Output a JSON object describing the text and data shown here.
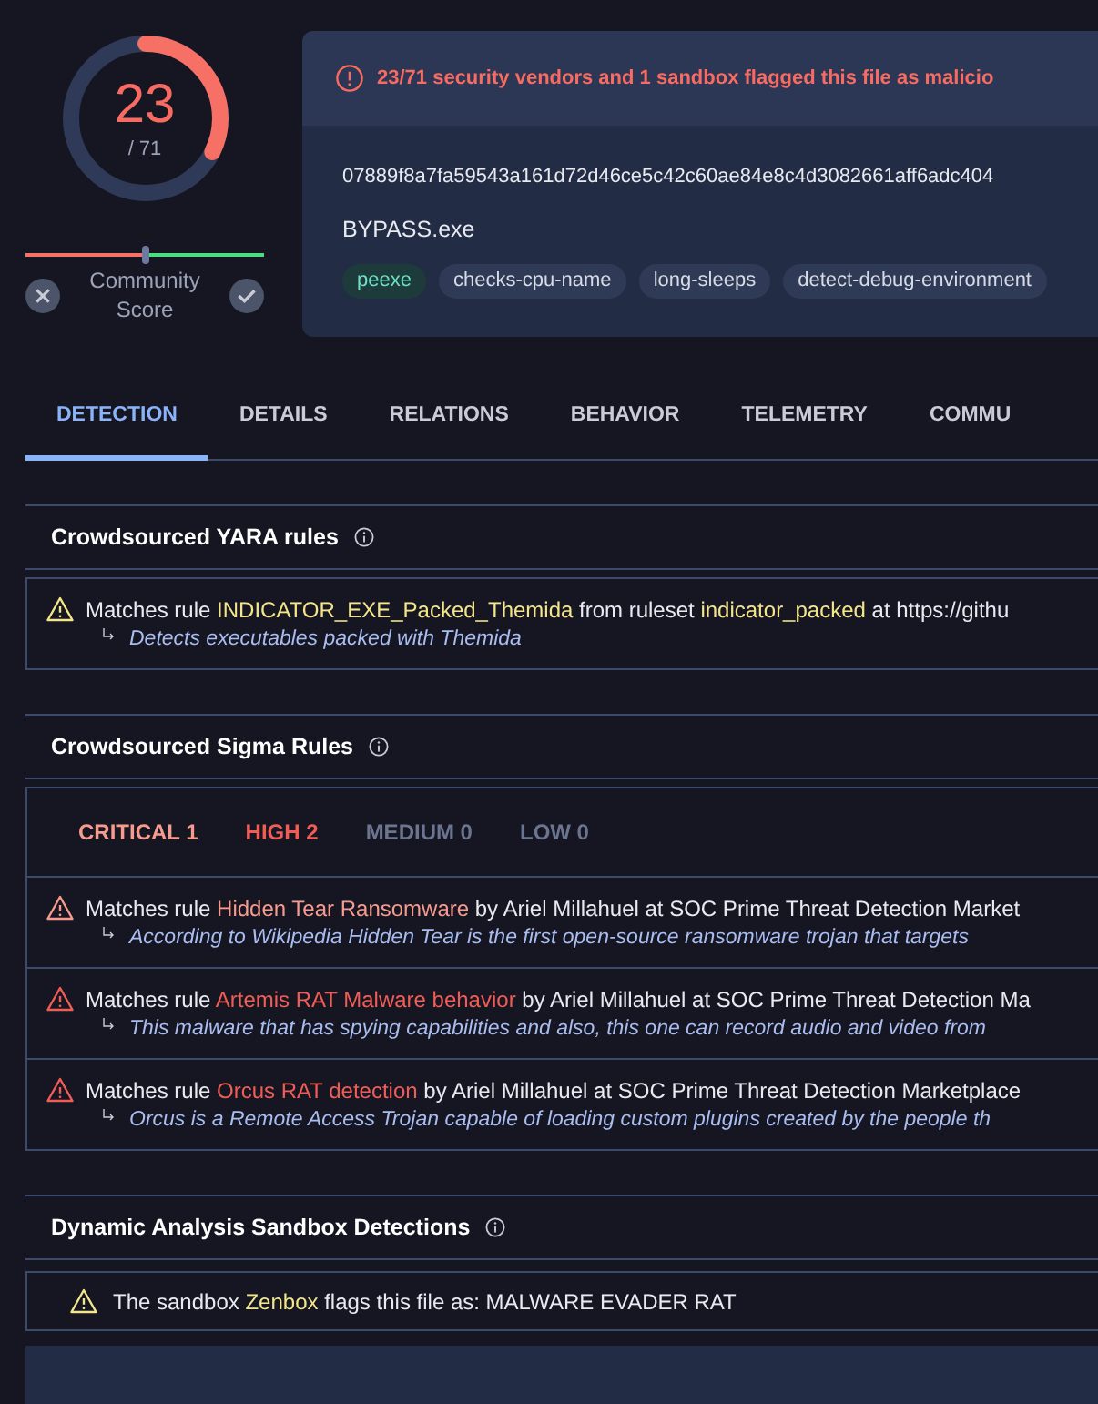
{
  "score": {
    "detections": "23",
    "total": "/ 71",
    "level": 0.324
  },
  "community": {
    "label": "Community Score",
    "level": 0.5
  },
  "alert": "23/71 security vendors and 1 sandbox flagged this file as malicio",
  "file": {
    "hash": "07889f8a7fa59543a161d72d46ce5c42c60ae84e8c4d3082661aff6adc404",
    "name": "BYPASS.exe"
  },
  "tags": [
    {
      "label": "peexe",
      "kind": "type"
    },
    {
      "label": "checks-cpu-name",
      "kind": "behavior"
    },
    {
      "label": "long-sleeps",
      "kind": "behavior"
    },
    {
      "label": "detect-debug-environment",
      "kind": "behavior"
    }
  ],
  "tabs": [
    {
      "label": "DETECTION",
      "selected": true
    },
    {
      "label": "DETAILS",
      "selected": false
    },
    {
      "label": "RELATIONS",
      "selected": false
    },
    {
      "label": "BEHAVIOR",
      "selected": false
    },
    {
      "label": "TELEMETRY",
      "selected": false
    },
    {
      "label": "COMMU",
      "selected": false
    }
  ],
  "yara": {
    "title": "Crowdsourced YARA rules",
    "rules": [
      {
        "prefix": "Matches rule",
        "rule": "INDICATOR_EXE_Packed_Themida",
        "middle": "from ruleset",
        "ruleset": "indicator_packed",
        "suffix": "at https://githu",
        "description": "Detects executables packed with Themida"
      }
    ]
  },
  "sigma": {
    "title": "Crowdsourced Sigma Rules",
    "levels": [
      {
        "label": "CRITICAL 1",
        "kind": "critical"
      },
      {
        "label": "HIGH 2",
        "kind": "high"
      },
      {
        "label": "MEDIUM 0",
        "kind": "medium"
      },
      {
        "label": "LOW 0",
        "kind": "low"
      }
    ],
    "rules": [
      {
        "kind": "critical",
        "prefix": "Matches rule",
        "rule": "Hidden Tear Ransomware",
        "suffix": "by Ariel Millahuel at SOC Prime Threat Detection Market",
        "description": "According to Wikipedia Hidden Tear is the first open-source ransomware trojan that targets"
      },
      {
        "kind": "high",
        "prefix": "Matches rule",
        "rule": "Artemis RAT Malware behavior",
        "suffix": "by Ariel Millahuel at SOC Prime Threat Detection Ma",
        "description": "This malware that has spying capabilities and also, this one can record audio and video from"
      },
      {
        "kind": "high",
        "prefix": "Matches rule",
        "rule": "Orcus RAT detection",
        "suffix": "by Ariel Millahuel at SOC Prime Threat Detection Marketplace",
        "description": "Orcus is a Remote Access Trojan capable of loading custom plugins created by the people th"
      }
    ]
  },
  "sandbox": {
    "title": "Dynamic Analysis Sandbox Detections",
    "items": [
      {
        "prefix": "The sandbox",
        "sandbox": "Zenbox",
        "suffix": "flags this file as: MALWARE EVADER RAT"
      }
    ]
  }
}
